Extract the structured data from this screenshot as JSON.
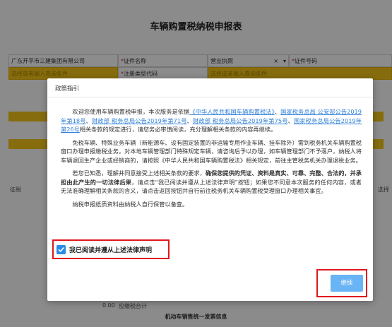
{
  "form": {
    "title": "车辆购置税纳税申报表",
    "company_name": "广东开平市三建集团有限公司",
    "id_name_label": "证件名称",
    "id_name_value": "营业执照",
    "id_number_label": "证件号码",
    "select_placeholder": "选择或者输入查询条件",
    "reg_type_label": "注册类型代码",
    "levy_label": "征税",
    "side_right": "选择",
    "amount_value": "0.00",
    "payable_label": "应缴税合计",
    "invoice_section": "机动车销售统一发票信息"
  },
  "modal": {
    "title": "政策指引",
    "p1": [
      {
        "t": "欢迎您使用车辆购置税申报，本次服务是依据",
        "s": ""
      },
      {
        "t": "《中华人民共和国车辆购置税法》",
        "s": "lnk"
      },
      {
        "t": "、",
        "s": ""
      },
      {
        "t": "国家税务总局 公安部公告2019年第18号",
        "s": "lnk"
      },
      {
        "t": "、",
        "s": ""
      },
      {
        "t": "财政部 税务总局公告2019年第71号",
        "s": "lnk"
      },
      {
        "t": "、",
        "s": ""
      },
      {
        "t": "财政部 税务总局公告2019年第75号",
        "s": "lnk"
      },
      {
        "t": "、",
        "s": ""
      },
      {
        "t": "国家税务总局公告2019年第26号",
        "s": "lnk"
      },
      {
        "t": "相关条款的规定进行，请您务必审慎阅读，充分理解相关条款的内容再继续。",
        "s": ""
      }
    ],
    "p2": [
      {
        "t": "免税车辆、特殊业务车辆（新能源车、设有固定装置的非运输专用作业车辆、挂车除外）需到税务机关车辆购置税窗口办理申报缴税业务。对本地车辆管理部门特殊规定车辆，请咨询后予以办理，如车辆管理部门不予落户，纳税人将车辆退回生产企业或经销商的，请按照《中华人民共和国车辆购置税法》相关规定，前往主管税务机关办理退税业务。",
        "s": ""
      }
    ],
    "p3": [
      {
        "t": "若您已知悉，理解并同意接受上述相关条款的要求，",
        "s": ""
      },
      {
        "t": "确保您提供的凭证、资料是真实、可靠、完整、合法的，并承担由此产生的一切法律后果",
        "s": "strong"
      },
      {
        "t": "，请点击“我已阅读并遵从上述法律声明”按钮；如果您不同意本次服务的任何内容，或者无法准确理解相关条款的含义，请点击返回按钮并自行前往税务机关车辆购置税受理窗口办理相关事宜。",
        "s": ""
      }
    ],
    "p4": [
      {
        "t": "纳税申报纸质资料由纳税人自行保管以备查。",
        "s": ""
      }
    ],
    "agree_label": "我已阅读并遵从上述法律声明",
    "agree_checked": true,
    "continue_label": "继续",
    "continue_color": "#69b4f5",
    "highlight_color": "#e1161e"
  }
}
